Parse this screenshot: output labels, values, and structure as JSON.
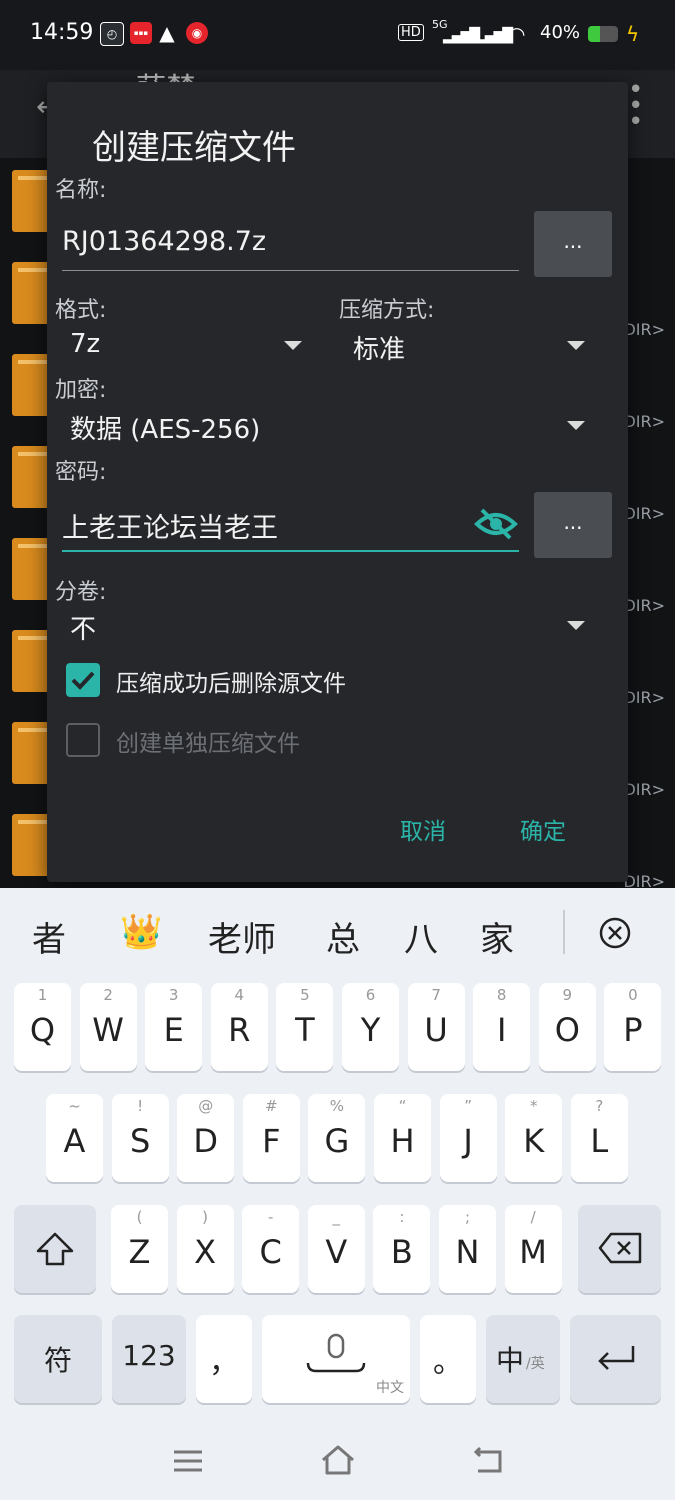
{
  "status_bar": {
    "time": "14:59",
    "battery": "40%",
    "network": "5G"
  },
  "background_app": {
    "title": "萨楚",
    "dir_label": "DIR>"
  },
  "dialog": {
    "title": "创建压缩文件",
    "name_label": "名称:",
    "name_value": "RJ01364298.7z",
    "format_label": "格式:",
    "format_value": "7z",
    "method_label": "压缩方式:",
    "method_value": "标准",
    "encrypt_label": "加密:",
    "encrypt_value": "数据 (AES-256)",
    "password_label": "密码:",
    "password_value": "上老王论坛当老王",
    "split_label": "分卷:",
    "split_value": "不",
    "delete_source_label": "压缩成功后删除源文件",
    "delete_source_checked": true,
    "separate_label": "创建单独压缩文件",
    "separate_checked": false,
    "browse_label": "...",
    "cancel": "取消",
    "ok": "确定"
  },
  "keyboard": {
    "candidates": [
      "者",
      "👑",
      "老师",
      "总",
      "八",
      "家"
    ],
    "row1": [
      {
        "k": "Q",
        "h": "1"
      },
      {
        "k": "W",
        "h": "2"
      },
      {
        "k": "E",
        "h": "3"
      },
      {
        "k": "R",
        "h": "4"
      },
      {
        "k": "T",
        "h": "5"
      },
      {
        "k": "Y",
        "h": "6"
      },
      {
        "k": "U",
        "h": "7"
      },
      {
        "k": "I",
        "h": "8"
      },
      {
        "k": "O",
        "h": "9"
      },
      {
        "k": "P",
        "h": "0"
      }
    ],
    "row2": [
      {
        "k": "A",
        "h": "~"
      },
      {
        "k": "S",
        "h": "!"
      },
      {
        "k": "D",
        "h": "@"
      },
      {
        "k": "F",
        "h": "#"
      },
      {
        "k": "G",
        "h": "%"
      },
      {
        "k": "H",
        "h": "“"
      },
      {
        "k": "J",
        "h": "”"
      },
      {
        "k": "K",
        "h": "*"
      },
      {
        "k": "L",
        "h": "?"
      }
    ],
    "row3": [
      {
        "k": "Z",
        "h": "("
      },
      {
        "k": "X",
        "h": ")"
      },
      {
        "k": "C",
        "h": "-"
      },
      {
        "k": "V",
        "h": "_"
      },
      {
        "k": "B",
        "h": ":"
      },
      {
        "k": "N",
        "h": ";"
      },
      {
        "k": "M",
        "h": "/"
      }
    ],
    "symbol_key": "符",
    "number_key": "123",
    "comma_key": "，",
    "period_key": "。",
    "space_sub": "中文",
    "lang_main": "中",
    "lang_sub": "/英"
  },
  "colors": {
    "accent": "#2bb5a8",
    "dialog_bg": "#25272b",
    "keyboard_bg": "#edf0f5",
    "folder": "#d98b1e"
  }
}
